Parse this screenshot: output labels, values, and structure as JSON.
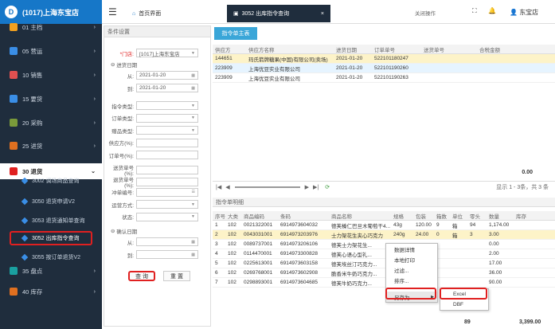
{
  "store_title": "(1017)上海东宝店",
  "user": "东宝店",
  "close_ops": "关闭操作",
  "tabs": [
    "首页界面",
    "3052 出库指令查询"
  ],
  "menu": [
    {
      "label": "01 主档",
      "color": "#f0a020"
    },
    {
      "label": "05 营运",
      "color": "#3a8ee6"
    },
    {
      "label": "10 销售",
      "color": "#e05050"
    },
    {
      "label": "15 要货",
      "color": "#3a8ee6"
    },
    {
      "label": "20 采购",
      "color": "#7a9a3a"
    },
    {
      "label": "25 进货",
      "color": "#e07020"
    },
    {
      "label": "30 退货",
      "color": "#e02020"
    }
  ],
  "submenu": [
    "3002 调场商品查询",
    "3050 退货申请V2",
    "3053 退货通知单查询",
    "3052 出库指令查询",
    "3055 按订单退货V2"
  ],
  "menu_bottom": [
    {
      "label": "35 盘点",
      "color": "#1aa0a0"
    },
    {
      "label": "40 库存",
      "color": "#e07020"
    }
  ],
  "filter": {
    "title": "条件设置",
    "store_label": "*门店:",
    "store_value": "[1017]上海东宝店",
    "date_section": "进货日期",
    "from_label": "从:",
    "from_value": "2021-01-20",
    "to_label": "到:",
    "to_value": "2021-01-20",
    "fields": [
      "指令类型:",
      "订单类型:",
      "赠品类型:",
      "供应方(%):",
      "订单号(%):",
      "送货单号(%):",
      "退货单号(%):",
      "冲单编号:",
      "运营方式:",
      "状态:"
    ],
    "confirm_section": "确认日期",
    "from2": "从:",
    "to2": "到:",
    "query": "查 询",
    "reset": "重 置"
  },
  "main_tab": "指令单主表",
  "master": {
    "headers": [
      "供应方",
      "供应方名称",
      "进货日期",
      "订单单号",
      "送货单号",
      "合税金额"
    ],
    "rows": [
      [
        "144651",
        "玛氏箭牌糖果(中国)有限公司(卖场)",
        "2021-01-20",
        "522101180247",
        ""
      ],
      [
        "223909",
        "上海优豆实业有限公司",
        "2021-01-20",
        "522101190260",
        ""
      ],
      [
        "223909",
        "上海优豆实业有限公司",
        "2021-01-20",
        "522101190263",
        ""
      ]
    ],
    "total": "0.00",
    "pager": "显示 1 - 3条，共 3 条"
  },
  "detail": {
    "title": "指令单明细",
    "headers": [
      "序号",
      "大类",
      "商品编码",
      "条码",
      "商品名称",
      "规格",
      "包装",
      "箱数",
      "单位",
      "零头",
      "数量",
      "库存"
    ],
    "rows": [
      [
        "1",
        "102",
        "0021322001",
        "6914973604032",
        "德芙榛仁巴旦木葡萄干4...",
        "43g",
        "120.00",
        "9",
        "箱",
        "94",
        "1,174.00"
      ],
      [
        "2",
        "102",
        "0043031001",
        "6914973203976",
        "士力架花生夹心巧克力",
        "240g",
        "24.00",
        "0",
        "箱",
        "3",
        "3.00"
      ],
      [
        "3",
        "102",
        "0089737001",
        "6914973206106",
        "德芙士力架花生...",
        "",
        "",
        "",
        "",
        "",
        "0.00"
      ],
      [
        "4",
        "102",
        "0114470001",
        "6914973300828",
        "德芙心语心型礼...",
        "",
        "",
        "",
        "",
        "",
        "2.00"
      ],
      [
        "5",
        "102",
        "0225613001",
        "6914973603158",
        "德芙埃丝汀巧克力...",
        "",
        "",
        "",
        "",
        "",
        "17.00"
      ],
      [
        "6",
        "102",
        "0269768001",
        "6914973602908",
        "脆香米牛奶巧克力...",
        "",
        "",
        "",
        "",
        "",
        "36.00"
      ],
      [
        "7",
        "102",
        "0298893001",
        "6914973604685",
        "德芙牛奶巧克力...",
        "",
        "",
        "",
        "",
        "",
        "90.00"
      ]
    ],
    "total_boxes": "89",
    "total_qty": "3,399.00"
  },
  "context_menu": [
    "数据详情",
    "本地打印",
    "过滤...",
    "排序...",
    "另存为"
  ],
  "save_as": [
    "Excel",
    "DBF"
  ]
}
